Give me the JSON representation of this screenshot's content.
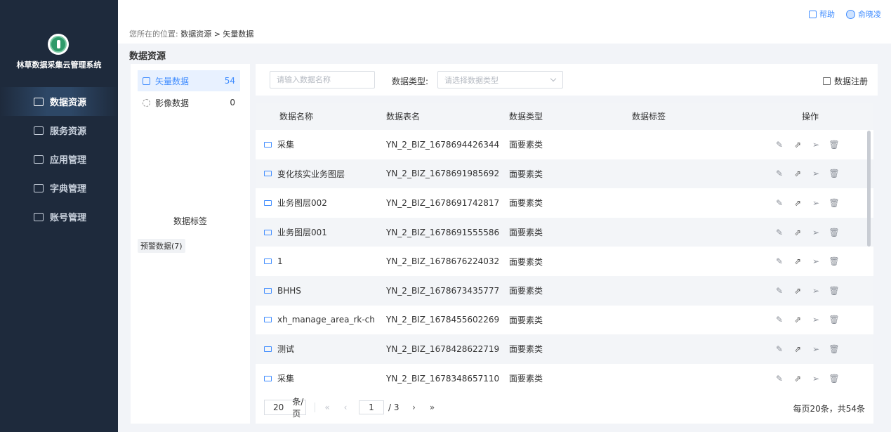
{
  "app": {
    "title": "林草数据采集云管理系统"
  },
  "nav": [
    {
      "label": "数据资源",
      "active": true
    },
    {
      "label": "服务资源",
      "active": false
    },
    {
      "label": "应用管理",
      "active": false
    },
    {
      "label": "字典管理",
      "active": false
    },
    {
      "label": "账号管理",
      "active": false
    }
  ],
  "header": {
    "breadcrumb_prefix": "您所在的位置:",
    "breadcrumb_path": "数据资源 > 矢量数据",
    "help": "帮助",
    "user": "俞晓凌"
  },
  "page": {
    "title": "数据资源"
  },
  "categories": [
    {
      "name": "矢量数据",
      "count": "54",
      "active": true
    },
    {
      "name": "影像数据",
      "count": "0",
      "active": false
    }
  ],
  "tags": {
    "heading": "数据标签",
    "items": [
      "预警数据(7)"
    ]
  },
  "filter": {
    "search_placeholder": "请输入数据名称",
    "type_label": "数据类型:",
    "type_placeholder": "请选择数据类型",
    "register_label": "数据注册"
  },
  "table": {
    "headers": [
      "数据名称",
      "数据表名",
      "数据类型",
      "数据标签",
      "操作"
    ],
    "rows": [
      {
        "name": "采集",
        "table": "YN_2_BIZ_1678694426344",
        "type": "面要素类",
        "tag": ""
      },
      {
        "name": "变化核实业务图层",
        "table": "YN_2_BIZ_1678691985692",
        "type": "面要素类",
        "tag": ""
      },
      {
        "name": "业务图层002",
        "table": "YN_2_BIZ_1678691742817",
        "type": "面要素类",
        "tag": ""
      },
      {
        "name": "业务图层001",
        "table": "YN_2_BIZ_1678691555586",
        "type": "面要素类",
        "tag": ""
      },
      {
        "name": "1",
        "table": "YN_2_BIZ_1678676224032",
        "type": "面要素类",
        "tag": ""
      },
      {
        "name": "BHHS",
        "table": "YN_2_BIZ_1678673435777",
        "type": "面要素类",
        "tag": ""
      },
      {
        "name": "xh_manage_area_rk-ch",
        "table": "YN_2_BIZ_1678455602269",
        "type": "面要素类",
        "tag": ""
      },
      {
        "name": "测试",
        "table": "YN_2_BIZ_1678428622719",
        "type": "面要素类",
        "tag": ""
      },
      {
        "name": "采集",
        "table": "YN_2_BIZ_1678348657110",
        "type": "面要素类",
        "tag": ""
      }
    ]
  },
  "pagination": {
    "page_size": "20",
    "page_size_unit": "条/页",
    "current_page": "1",
    "total_pages": "/ 3",
    "summary": "每页20条，共54条"
  },
  "colors": {
    "accent": "#3f8cff",
    "sidebar_bg": "#1e2a3c",
    "row_alt": "#f3f5f8"
  }
}
